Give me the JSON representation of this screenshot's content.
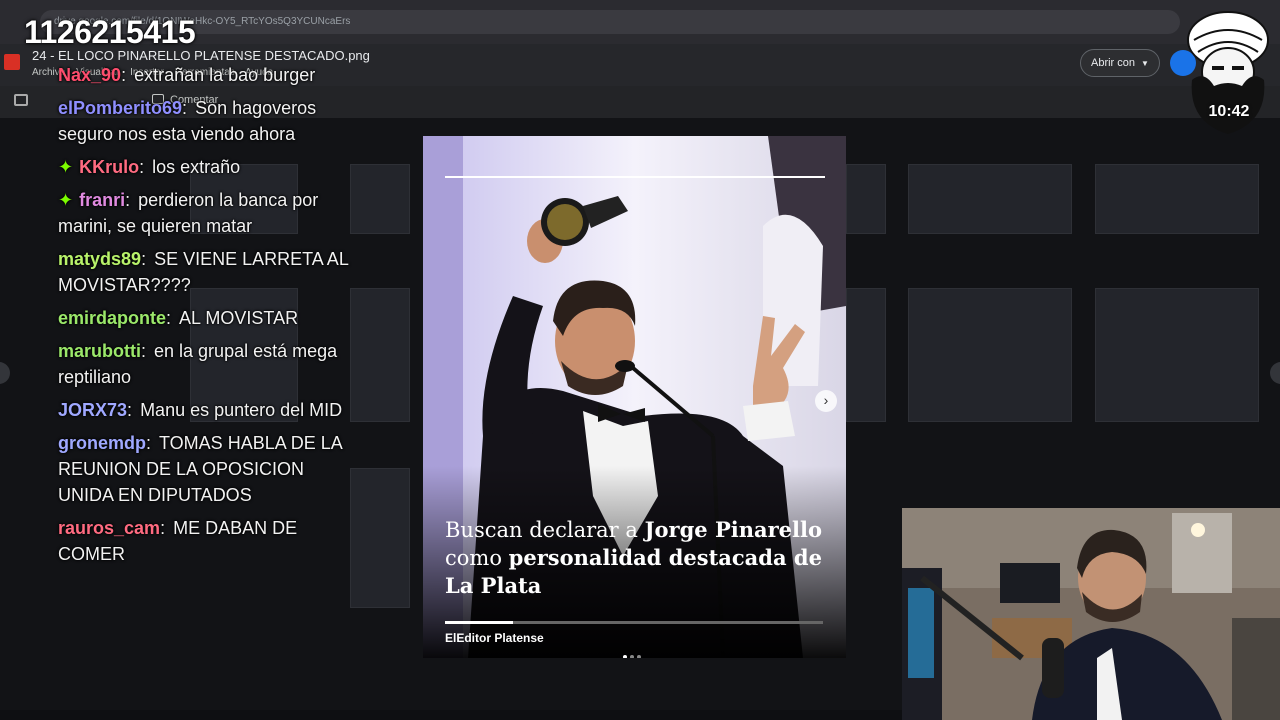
{
  "browser": {
    "url": "drive.google.com/file/d/1ONIWeHkc-OY5_RTcYOs5Q3YCUNcaErs",
    "file_title": "24 - EL LOCO PINARELLO PLATENSE DESTACADO.png",
    "menu": [
      "Archivo",
      "Visualizar",
      "Insertar",
      "Herramientas",
      "Ayuda"
    ],
    "open_with_label": "Abrir con",
    "comment_label": "Comentar"
  },
  "stream": {
    "id_number": "1126215415",
    "timer": "10:42"
  },
  "chat": {
    "messages": [
      {
        "user": "Nax_90",
        "text": "extrañan la bao burger",
        "color": "#ff4d6d",
        "badge": false
      },
      {
        "user": "elPomberito69",
        "text": "Son hagoveros seguro nos esta viendo ahora",
        "color": "#8f8fff",
        "badge": false
      },
      {
        "user": "KKrulo",
        "text": "los extraño",
        "color": "#ff6b81",
        "badge": true
      },
      {
        "user": "franri",
        "text": "perdieron la banca por marini, se quieren matar",
        "color": "#e08ae0",
        "badge": true
      },
      {
        "user": "matyds89",
        "text": "SE VIENE LARRETA AL MOVISTAR????",
        "color": "#b8f26a",
        "badge": false
      },
      {
        "user": "emirdaponte",
        "text": "AL MOVISTAR",
        "color": "#9be86a",
        "badge": false
      },
      {
        "user": "marubotti",
        "text": "en la grupal está mega reptiliano",
        "color": "#9be86a",
        "badge": false
      },
      {
        "user": "JORX73",
        "text": "Manu es puntero del MID",
        "color": "#9fa8ff",
        "badge": false
      },
      {
        "user": "gronemdp",
        "text": "TOMAS HABLA DE LA REUNION DE LA OPOSICION UNIDA EN DIPUTADOS",
        "color": "#9fa8ff",
        "badge": false
      },
      {
        "user": "rauros_cam",
        "text": "ME DABAN DE COMER",
        "color": "#ff6b81",
        "badge": false
      }
    ],
    "separator": ":"
  },
  "post": {
    "headline_pre": "Buscan declarar a",
    "headline_name": "Jorge Pinarello",
    "headline_mid": "como",
    "headline_bold2": "personalidad destacada de La Plata",
    "brand": "ElEditor Platense",
    "progress_fraction": 0.18,
    "story_fraction": 1.0
  },
  "colors": {
    "accent_blue": "#1a73e8",
    "badge_green": "#7cfc00"
  },
  "icons": {
    "next": "chevron-right-icon",
    "badge": "sparkle-icon"
  }
}
